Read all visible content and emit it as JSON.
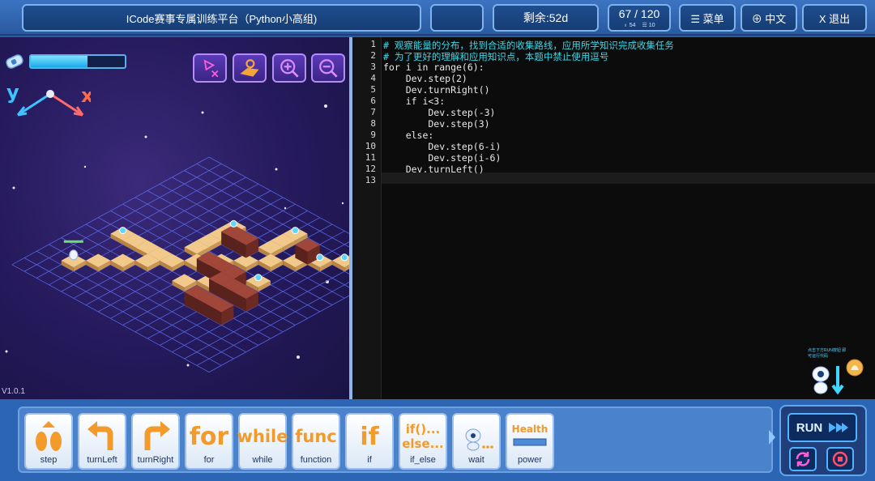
{
  "header": {
    "title": "ICode赛事专属训练平台（Python小高组)",
    "remaining": "剩余:52d",
    "progress": "67 / 120",
    "progress_likes": "54",
    "progress_list": "10",
    "menu_label": "☰ 菜单",
    "lang_label": "⊕ 中文",
    "exit_label": "X 退出"
  },
  "scene": {
    "energy_level": 0.6,
    "axis_y": "y",
    "axis_x": "x",
    "version": "V1.0.1",
    "icons": [
      "music-skip-icon",
      "map-icon",
      "zoom-in-icon",
      "zoom-out-icon"
    ]
  },
  "editor": {
    "line_numbers": [
      "1",
      "2",
      "3",
      "4",
      "5",
      "6",
      "7",
      "8",
      "9",
      "10",
      "11",
      "12",
      "13"
    ],
    "lines": [
      "# 观察能量的分布，找到合适的收集路线，应用所学知识完成收集任务",
      "# 为了更好的理解和应用知识点，本题中禁止使用逗号",
      "for i in range(6):",
      "    Dev.step(2)",
      "    Dev.turnRight()",
      "    if i<3:",
      "        Dev.step(-3)",
      "        Dev.step(3)",
      "    else:",
      "        Dev.step(6-i)",
      "        Dev.step(i-6)",
      "    Dev.turnLeft()",
      ""
    ]
  },
  "robot_hint": {
    "text": "点击下方RUN按钮 即可运行代码"
  },
  "blocks": [
    {
      "label": "step",
      "art": "step"
    },
    {
      "label": "turnLeft",
      "art": "turnLeft"
    },
    {
      "label": "turnRight",
      "art": "turnRight"
    },
    {
      "label": "for",
      "art": "for"
    },
    {
      "label": "while",
      "art": "while"
    },
    {
      "label": "function",
      "art": "func"
    },
    {
      "label": "if",
      "art": "if"
    },
    {
      "label": "if_else",
      "art": "if()... else..."
    },
    {
      "label": "wait",
      "art": "wait"
    },
    {
      "label": "power",
      "art": "Health"
    }
  ],
  "controls": {
    "run_label": "RUN"
  },
  "colors": {
    "accent": "#3fd6e6",
    "block_orange": "#f29a2a",
    "header_blue": "#2a5aa0"
  }
}
